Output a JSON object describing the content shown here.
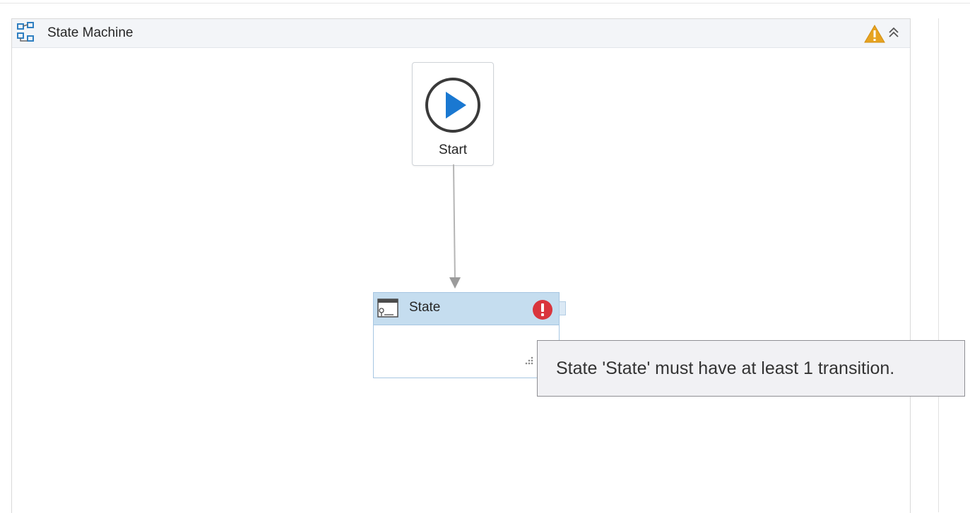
{
  "state_machine": {
    "title": "State Machine",
    "header_icon": "state-machine-icon",
    "warning_icon": "warning-icon",
    "collapse_icon": "collapse-up-icon"
  },
  "start_node": {
    "label": "Start",
    "icon": "play-icon"
  },
  "state_node": {
    "label": "State",
    "icon": "state-icon",
    "status_icon": "error-icon"
  },
  "tooltip": {
    "text": "State 'State' must have at least 1 transition."
  },
  "colors": {
    "state_header": "#c5ddef",
    "play_accent": "#1a78d1",
    "warning": "#e7a320",
    "error": "#d9353d"
  }
}
